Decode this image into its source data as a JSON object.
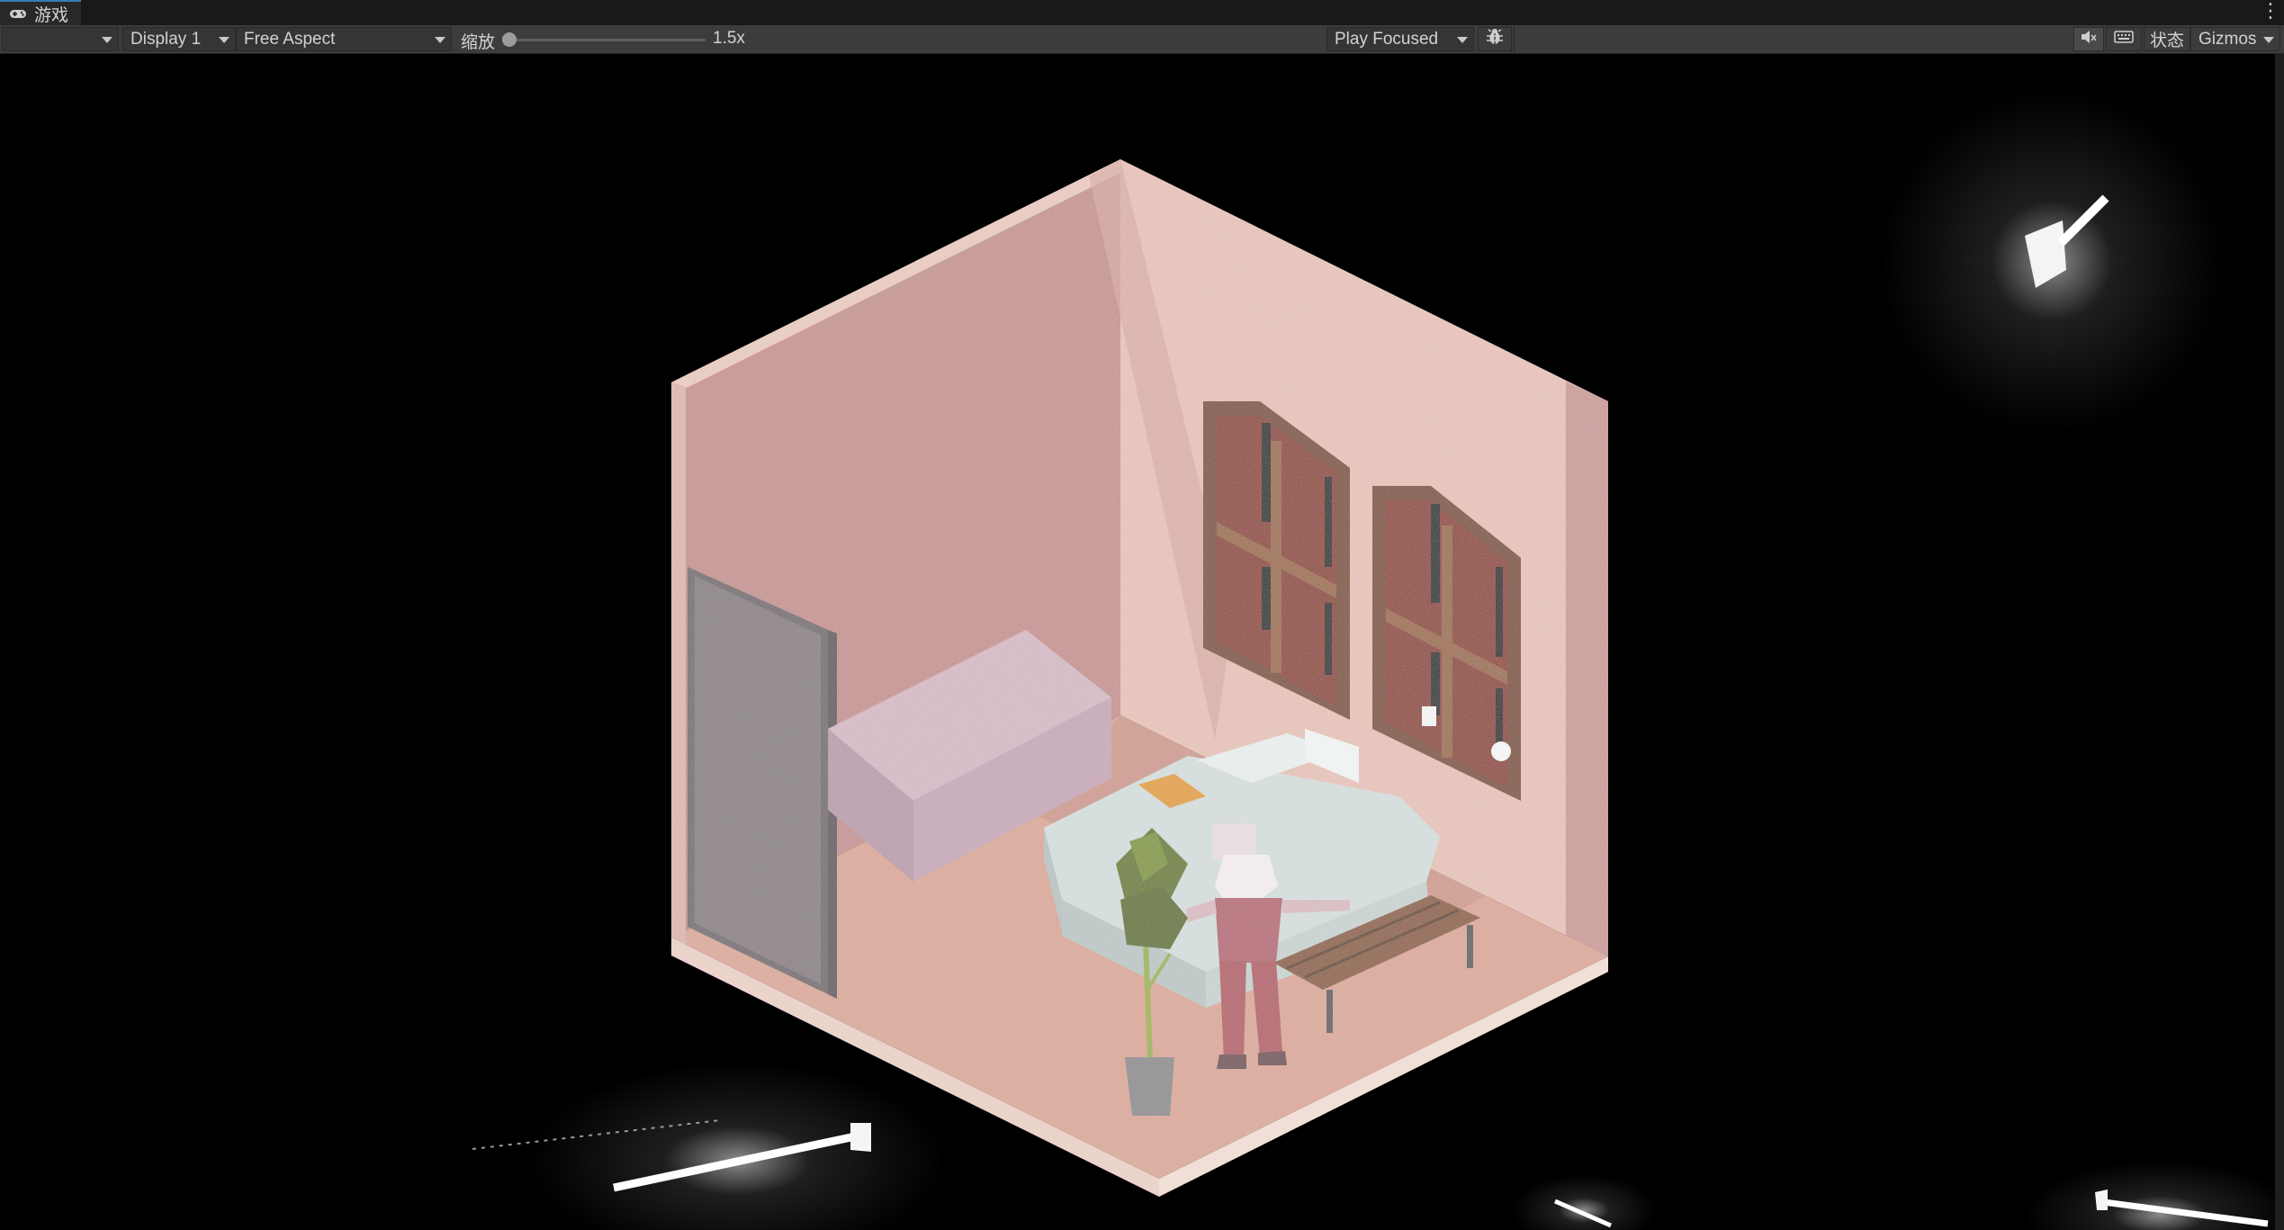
{
  "window": {
    "tab_title": "游戏",
    "tab_icon": "gamepad-icon",
    "menu_icon": "more-vertical-icon"
  },
  "toolbar": {
    "game_view_select": "",
    "display": "Display 1",
    "aspect": "Free Aspect",
    "zoom_label": "缩放",
    "zoom_value": "1.5x",
    "play_mode": "Play Focused",
    "debug_icon": "bug-icon",
    "mute_icon": "mute-audio-icon",
    "stats_icon": "keyboard-icon",
    "stats_label": "状态",
    "gizmos_label": "Gizmos"
  },
  "scene": {
    "description_icon": "isometric-room-render",
    "colors": {
      "wall_light": "#e6c3b8",
      "wall_mid": "#cfa3a0",
      "wall_dark": "#b98183",
      "floor": "#d7a79a",
      "shelf_wood": "#7a4a2e",
      "door": "#7d7478",
      "bed": "#cbd3d2",
      "sofa": "#c5a9b5",
      "plant": "#6c7d2e",
      "character": "#b05a64",
      "light_glow": "#ffffff"
    }
  }
}
